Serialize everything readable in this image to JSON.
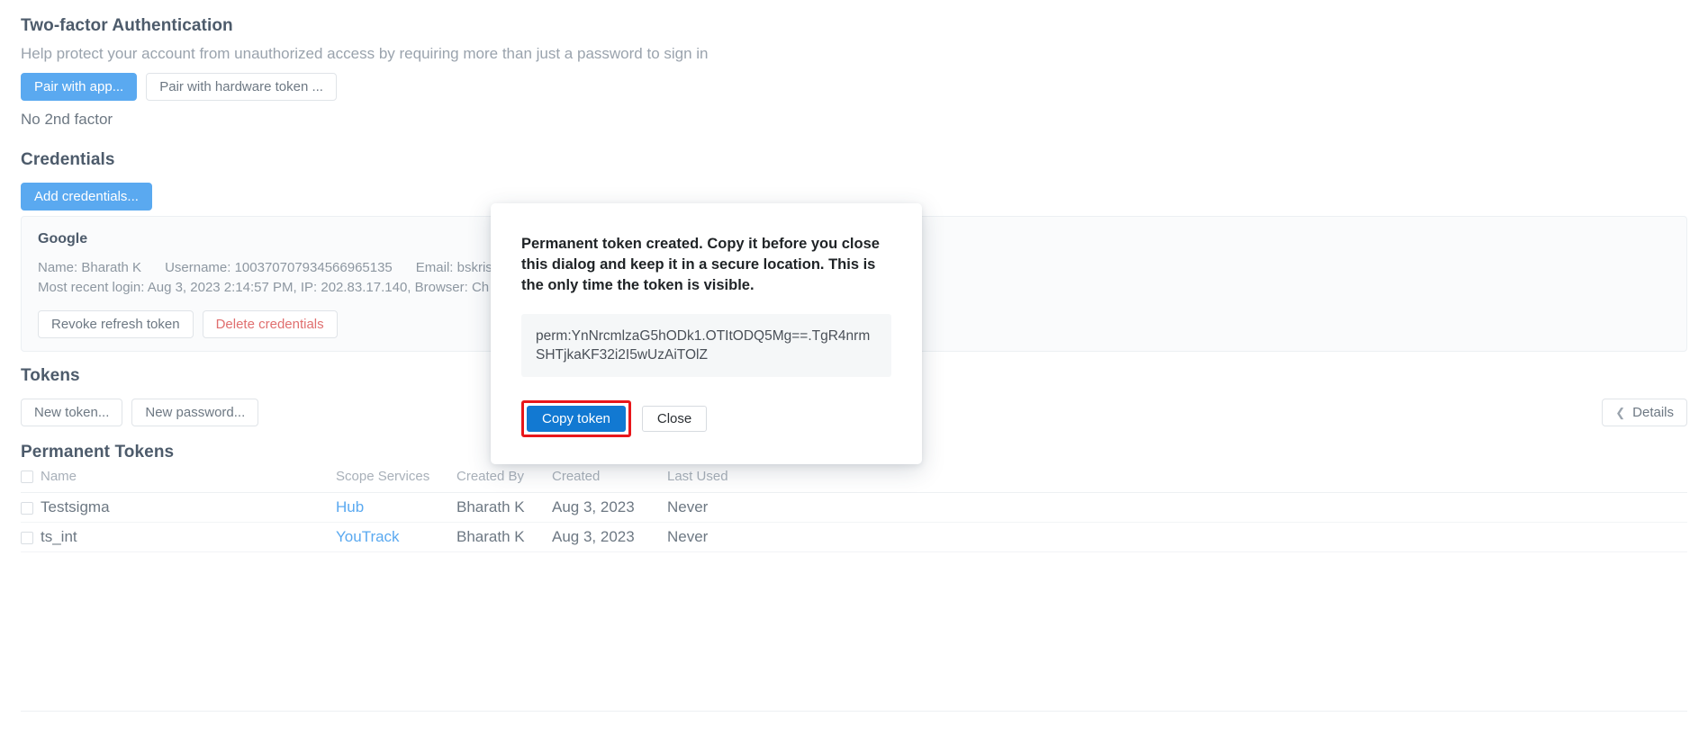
{
  "two_factor": {
    "title": "Two-factor Authentication",
    "description": "Help protect your account from unauthorized access by requiring more than just a password to sign in",
    "pair_app_label": "Pair with app...",
    "pair_hardware_label": "Pair with hardware token ...",
    "status": "No 2nd factor"
  },
  "credentials": {
    "title": "Credentials",
    "add_label": "Add credentials...",
    "provider": "Google",
    "name_label": "Name: Bharath K",
    "username_label": "Username: 100370707934566965135",
    "email_label": "Email: bskrish",
    "recent_login": "Most recent login: Aug 3, 2023 2:14:57 PM, IP: 202.83.17.140, Browser: Ch",
    "revoke_label": "Revoke refresh token",
    "delete_label": "Delete credentials"
  },
  "tokens": {
    "title": "Tokens",
    "new_token_label": "New token...",
    "new_password_label": "New password...",
    "details_label": "Details",
    "details_chevron": "chevron-left-icon"
  },
  "permanent_tokens": {
    "title": "Permanent Tokens",
    "columns": [
      "Name",
      "Scope Services",
      "Created By",
      "Created",
      "Last Used"
    ],
    "rows": [
      {
        "name": "Testsigma",
        "scope": "Hub",
        "created_by": "Bharath K",
        "created": "Aug 3, 2023",
        "last_used": "Never"
      },
      {
        "name": "ts_int",
        "scope": "YouTrack",
        "created_by": "Bharath K",
        "created": "Aug 3, 2023",
        "last_used": "Never"
      }
    ]
  },
  "dialog": {
    "message": "Permanent token created. Copy it before you close this dialog and keep it in a secure location. This is the only time the token is visible.",
    "token": "perm:YnNrcmlzaG5hODk1.OTItODQ5Mg==.TgR4nrmSHTjkaKF32i2I5wUzAiTOlZ",
    "copy_label": "Copy token",
    "close_label": "Close",
    "highlight_color": "#e8171b",
    "copy_button_color": "#1279d2"
  }
}
